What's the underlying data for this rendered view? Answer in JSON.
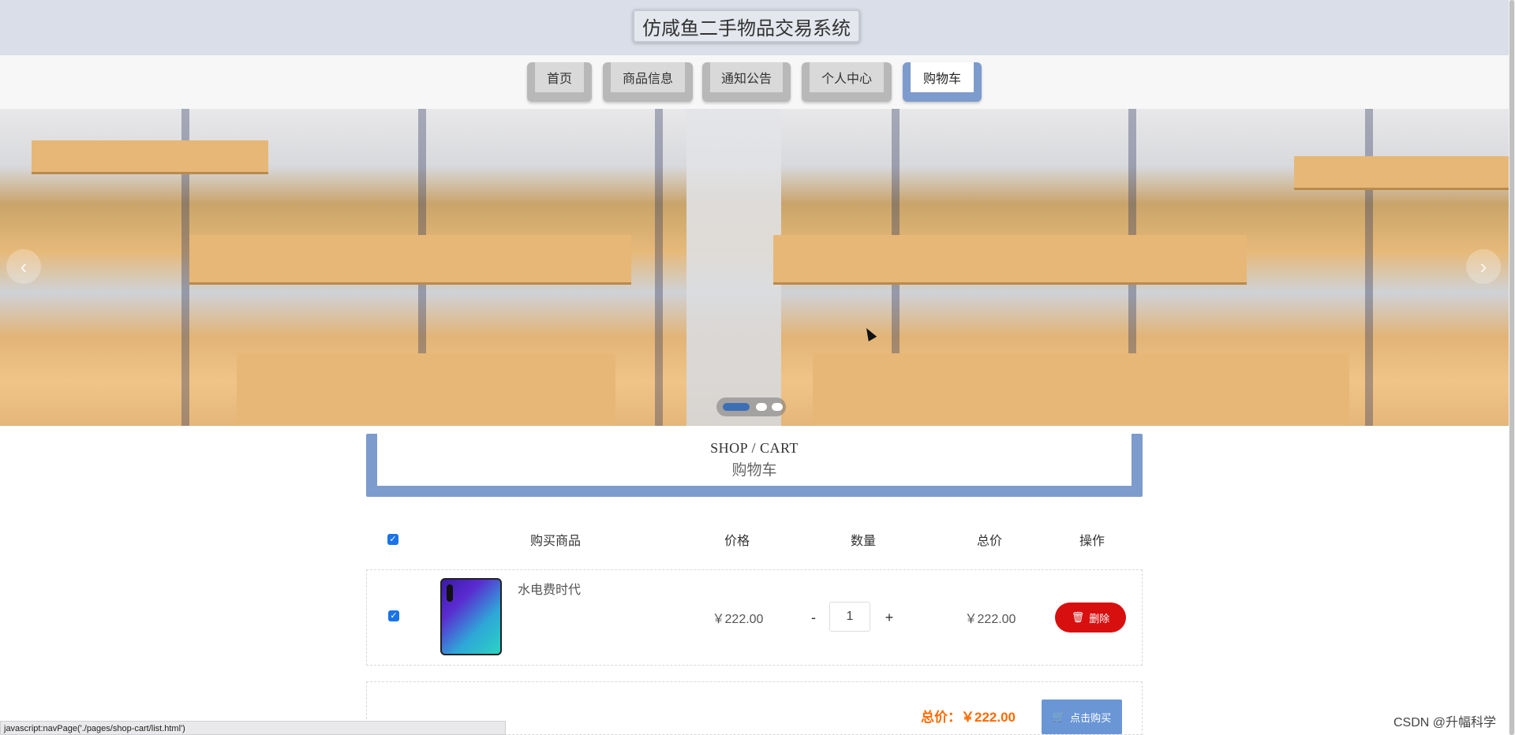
{
  "header": {
    "title": "仿咸鱼二手物品交易系统"
  },
  "nav": {
    "items": [
      {
        "label": "首页"
      },
      {
        "label": "商品信息"
      },
      {
        "label": "通知公告"
      },
      {
        "label": "个人中心"
      },
      {
        "label": "购物车"
      }
    ],
    "active": "购物车"
  },
  "banner": {
    "prev_icon": "chevron-left-icon",
    "next_icon": "chevron-right-icon",
    "slide_count": 3,
    "active_slide": 1
  },
  "section": {
    "title_en": "SHOP / CART",
    "title_cn": "购物车"
  },
  "table": {
    "headers": {
      "product": "购买商品",
      "price": "价格",
      "quantity": "数量",
      "total": "总价",
      "action": "操作"
    },
    "select_all_checked": true,
    "rows": [
      {
        "checked": true,
        "name": "水电费时代",
        "price": "￥222.00",
        "qty": "1",
        "total": "￥222.00",
        "delete_label": "删除",
        "minus": "-",
        "plus": "+"
      }
    ]
  },
  "summary": {
    "total_label": "总价：",
    "total_value": "￥222.00",
    "buy_label": "点击购买"
  },
  "status_bar": {
    "text": "javascript:navPage('./pages/shop-cart/list.html')"
  },
  "watermark": {
    "text": "CSDN @升幅科学"
  },
  "colors": {
    "accent": "#7d9bcd",
    "danger": "#d80f0f",
    "price_highlight": "#ff6a00",
    "buy_button": "#6a96d6"
  }
}
